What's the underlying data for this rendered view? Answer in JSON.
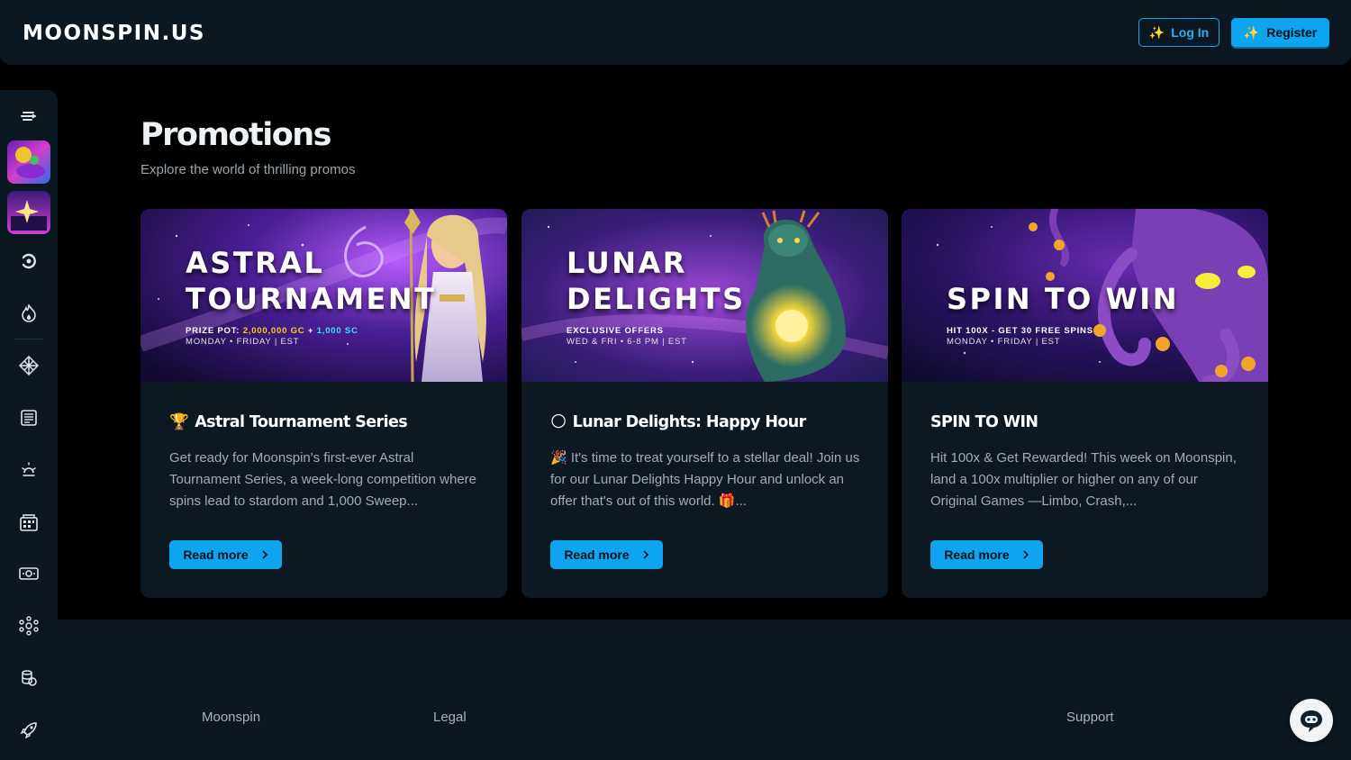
{
  "header": {
    "logo": "MOONSPIN.US",
    "login_label": "Log In",
    "register_label": "Register"
  },
  "sidebar": {
    "items": [
      {
        "icon": "menu-collapse-icon"
      },
      {
        "icon": "game-thumbnail-1"
      },
      {
        "icon": "game-thumbnail-2"
      },
      {
        "icon": "recent-icon"
      },
      {
        "icon": "hot-flame-icon"
      },
      {
        "icon": "diamond-icon"
      },
      {
        "icon": "news-icon"
      },
      {
        "icon": "sun-icon"
      },
      {
        "icon": "casino-building-icon"
      },
      {
        "icon": "cash-icon"
      },
      {
        "icon": "community-icon"
      },
      {
        "icon": "coins-icon"
      },
      {
        "icon": "rocket-icon"
      }
    ]
  },
  "main": {
    "title": "Promotions",
    "subtitle": "Explore the world of thrilling promos"
  },
  "promotions": [
    {
      "banner_title_line1": "ASTRAL",
      "banner_title_line2": "TOURNAMENT",
      "banner_sub_label": "PRIZE POT: ",
      "banner_sub_gc": "2,000,000 GC",
      "banner_sub_plus": " + ",
      "banner_sub_sc": "1,000 SC",
      "banner_schedule": "MONDAY • FRIDAY | EST",
      "emoji": "🏆",
      "title": "Astral Tournament Series",
      "text": "Get ready for Moonspin's first-ever Astral Tournament Series, a week-long competition where spins lead to stardom and 1,000 Sweep...",
      "button": "Read more"
    },
    {
      "banner_title_line1": "LUNAR",
      "banner_title_line2": "DELIGHTS",
      "banner_sub_label": "EXCLUSIVE OFFERS",
      "banner_schedule": "WED & FRI • 6-8 PM | EST",
      "emoji": "🌕",
      "title": "Lunar Delights: Happy Hour",
      "text": "🎉 It's time to treat yourself to a stellar deal! Join us for our Lunar Delights Happy Hour and unlock an offer that's out of this world. 🎁...",
      "button": "Read more"
    },
    {
      "banner_title_line1": "SPIN TO WIN",
      "banner_sub_label": "HIT 100X - GET 30 FREE SPINS",
      "banner_schedule": "MONDAY • FRIDAY | EST",
      "title": "SPIN TO WIN",
      "text": "Hit 100x & Get Rewarded! This week on Moonspin, land a 100x multiplier or higher on any of our Original Games —Limbo, Crash,...",
      "button": "Read more"
    }
  ],
  "footer": {
    "col1": "Moonspin",
    "col2": "Legal",
    "col3": "Support"
  },
  "colors": {
    "accent": "#0ea4ef",
    "panel": "#0c1923",
    "background": "#000000"
  }
}
